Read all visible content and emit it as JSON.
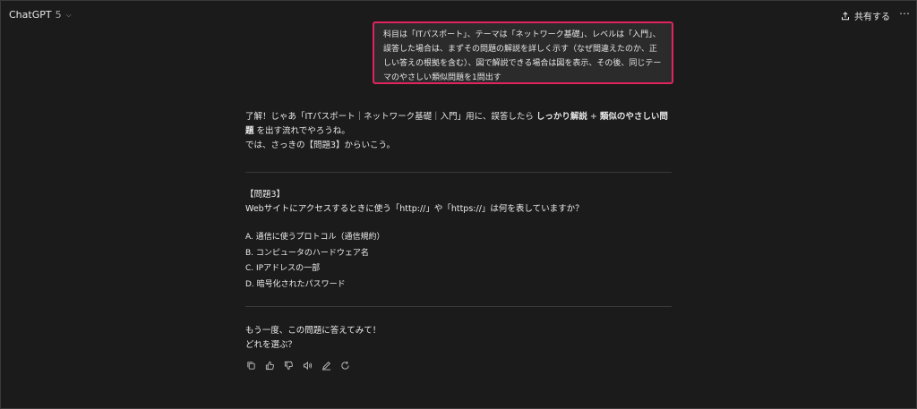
{
  "header": {
    "app_name": "ChatGPT",
    "model_version": "5",
    "share_label": "共有する"
  },
  "user_message": {
    "text": "科目は「ITパスポート」、テーマは「ネットワーク基礎」、レベルは「入門」、誤答した場合は、まずその問題の解説を詳しく示す（なぜ間違えたのか、正しい答えの根拠を含む）、図で解説できる場合は図を表示、その後、同じテーマのやさしい類似問題を1問出す"
  },
  "assistant": {
    "intro_part1": "了解！じゃあ「ITパスポート｜ネットワーク基礎｜入門」用に、誤答したら ",
    "intro_bold1": "しっかり解説",
    "intro_plus": " + ",
    "intro_bold2": "類似のやさしい問題",
    "intro_part2": " を出す流れでやろうね。",
    "intro_line2": "では、さっきの【問題3】からいこう。",
    "question_title": "【問題3】",
    "question_text": "Webサイトにアクセスするときに使う「http://」や「https://」は何を表していますか？",
    "choices": [
      "A. 通信に使うプロトコル（通信規約）",
      "B. コンピュータのハードウェア名",
      "C. IPアドレスの一部",
      "D. 暗号化されたパスワード"
    ],
    "closing_line1": "もう一度、この問題に答えてみて！",
    "closing_line2": "どれを選ぶ？"
  },
  "actions": [
    "copy-icon",
    "thumbs-up-icon",
    "thumbs-down-icon",
    "speaker-icon",
    "edit-icon",
    "regenerate-icon"
  ]
}
